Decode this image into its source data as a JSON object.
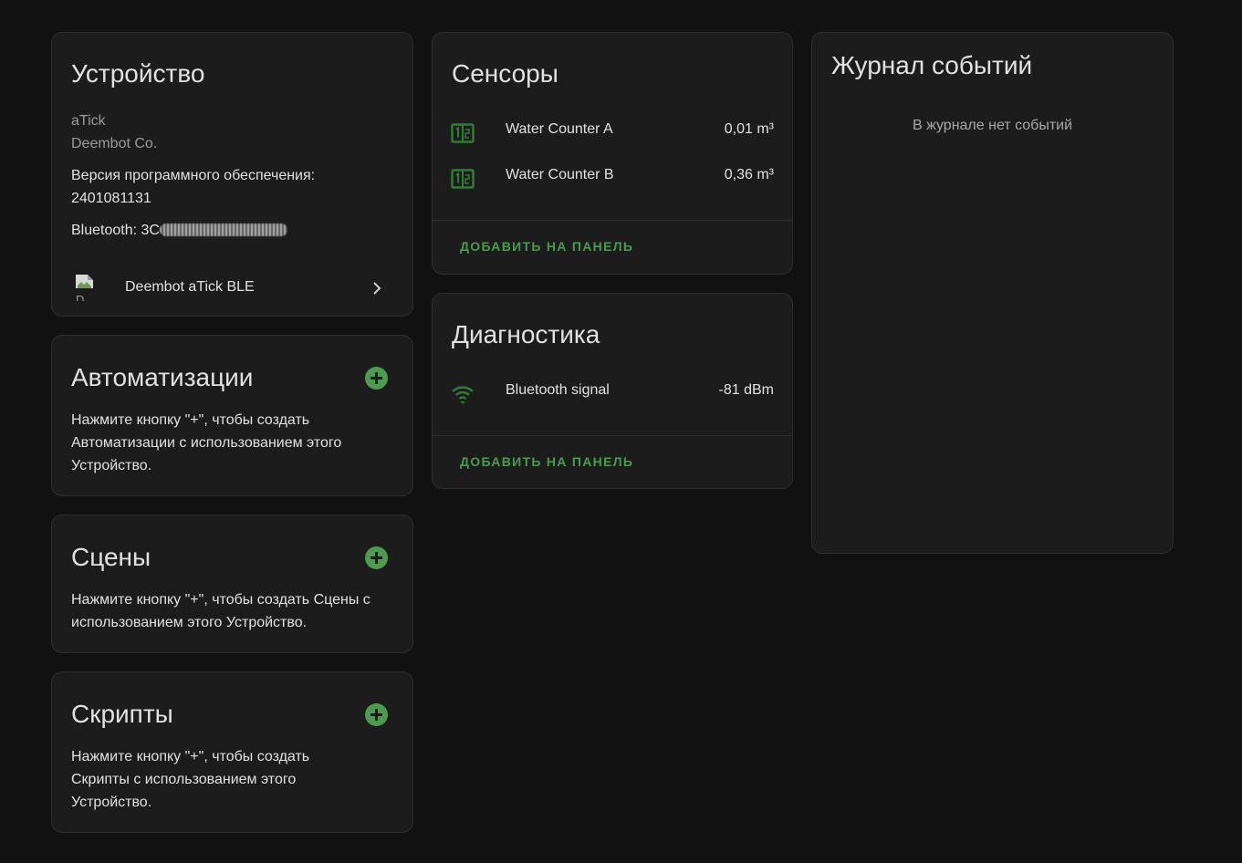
{
  "device": {
    "title": "Устройство",
    "model": "aTick",
    "manufacturer": "Deembot Co.",
    "firmware_label": "Версия программного обеспечения:",
    "firmware_value": "2401081131",
    "bluetooth_label": "Bluetooth: 3C",
    "integration_name": "Deembot aTick BLE",
    "integration_image_alt": "D"
  },
  "automations": {
    "title": "Автоматизации",
    "text": "Нажмите кнопку \"+\", чтобы создать Автоматизации с использованием этого Устройство."
  },
  "scenes": {
    "title": "Сцены",
    "text": "Нажмите кнопку \"+\", чтобы создать Сцены с использованием этого Устройство."
  },
  "scripts": {
    "title": "Скрипты",
    "text": "Нажмите кнопку \"+\", чтобы создать Скрипты с использованием этого Устройство."
  },
  "sensors": {
    "title": "Сенсоры",
    "items": [
      {
        "name": "Water Counter A",
        "value": "0,01 m³",
        "icon": "counter-icon"
      },
      {
        "name": "Water Counter B",
        "value": "0,36 m³",
        "icon": "counter-icon"
      }
    ],
    "add_label": "ДОБАВИТЬ НА ПАНЕЛЬ"
  },
  "diagnostics": {
    "title": "Диагностика",
    "items": [
      {
        "name": "Bluetooth signal",
        "value": "-81 dBm",
        "icon": "wifi-signal-icon"
      }
    ],
    "add_label": "ДОБАВИТЬ НА ПАНЕЛЬ"
  },
  "logbook": {
    "title": "Журнал событий",
    "empty_text": "В журнале нет событий"
  },
  "colors": {
    "background": "#111111",
    "card": "#1c1c1c",
    "accent_green": "#4a9b4f",
    "icon_green": "#2e7d32"
  }
}
